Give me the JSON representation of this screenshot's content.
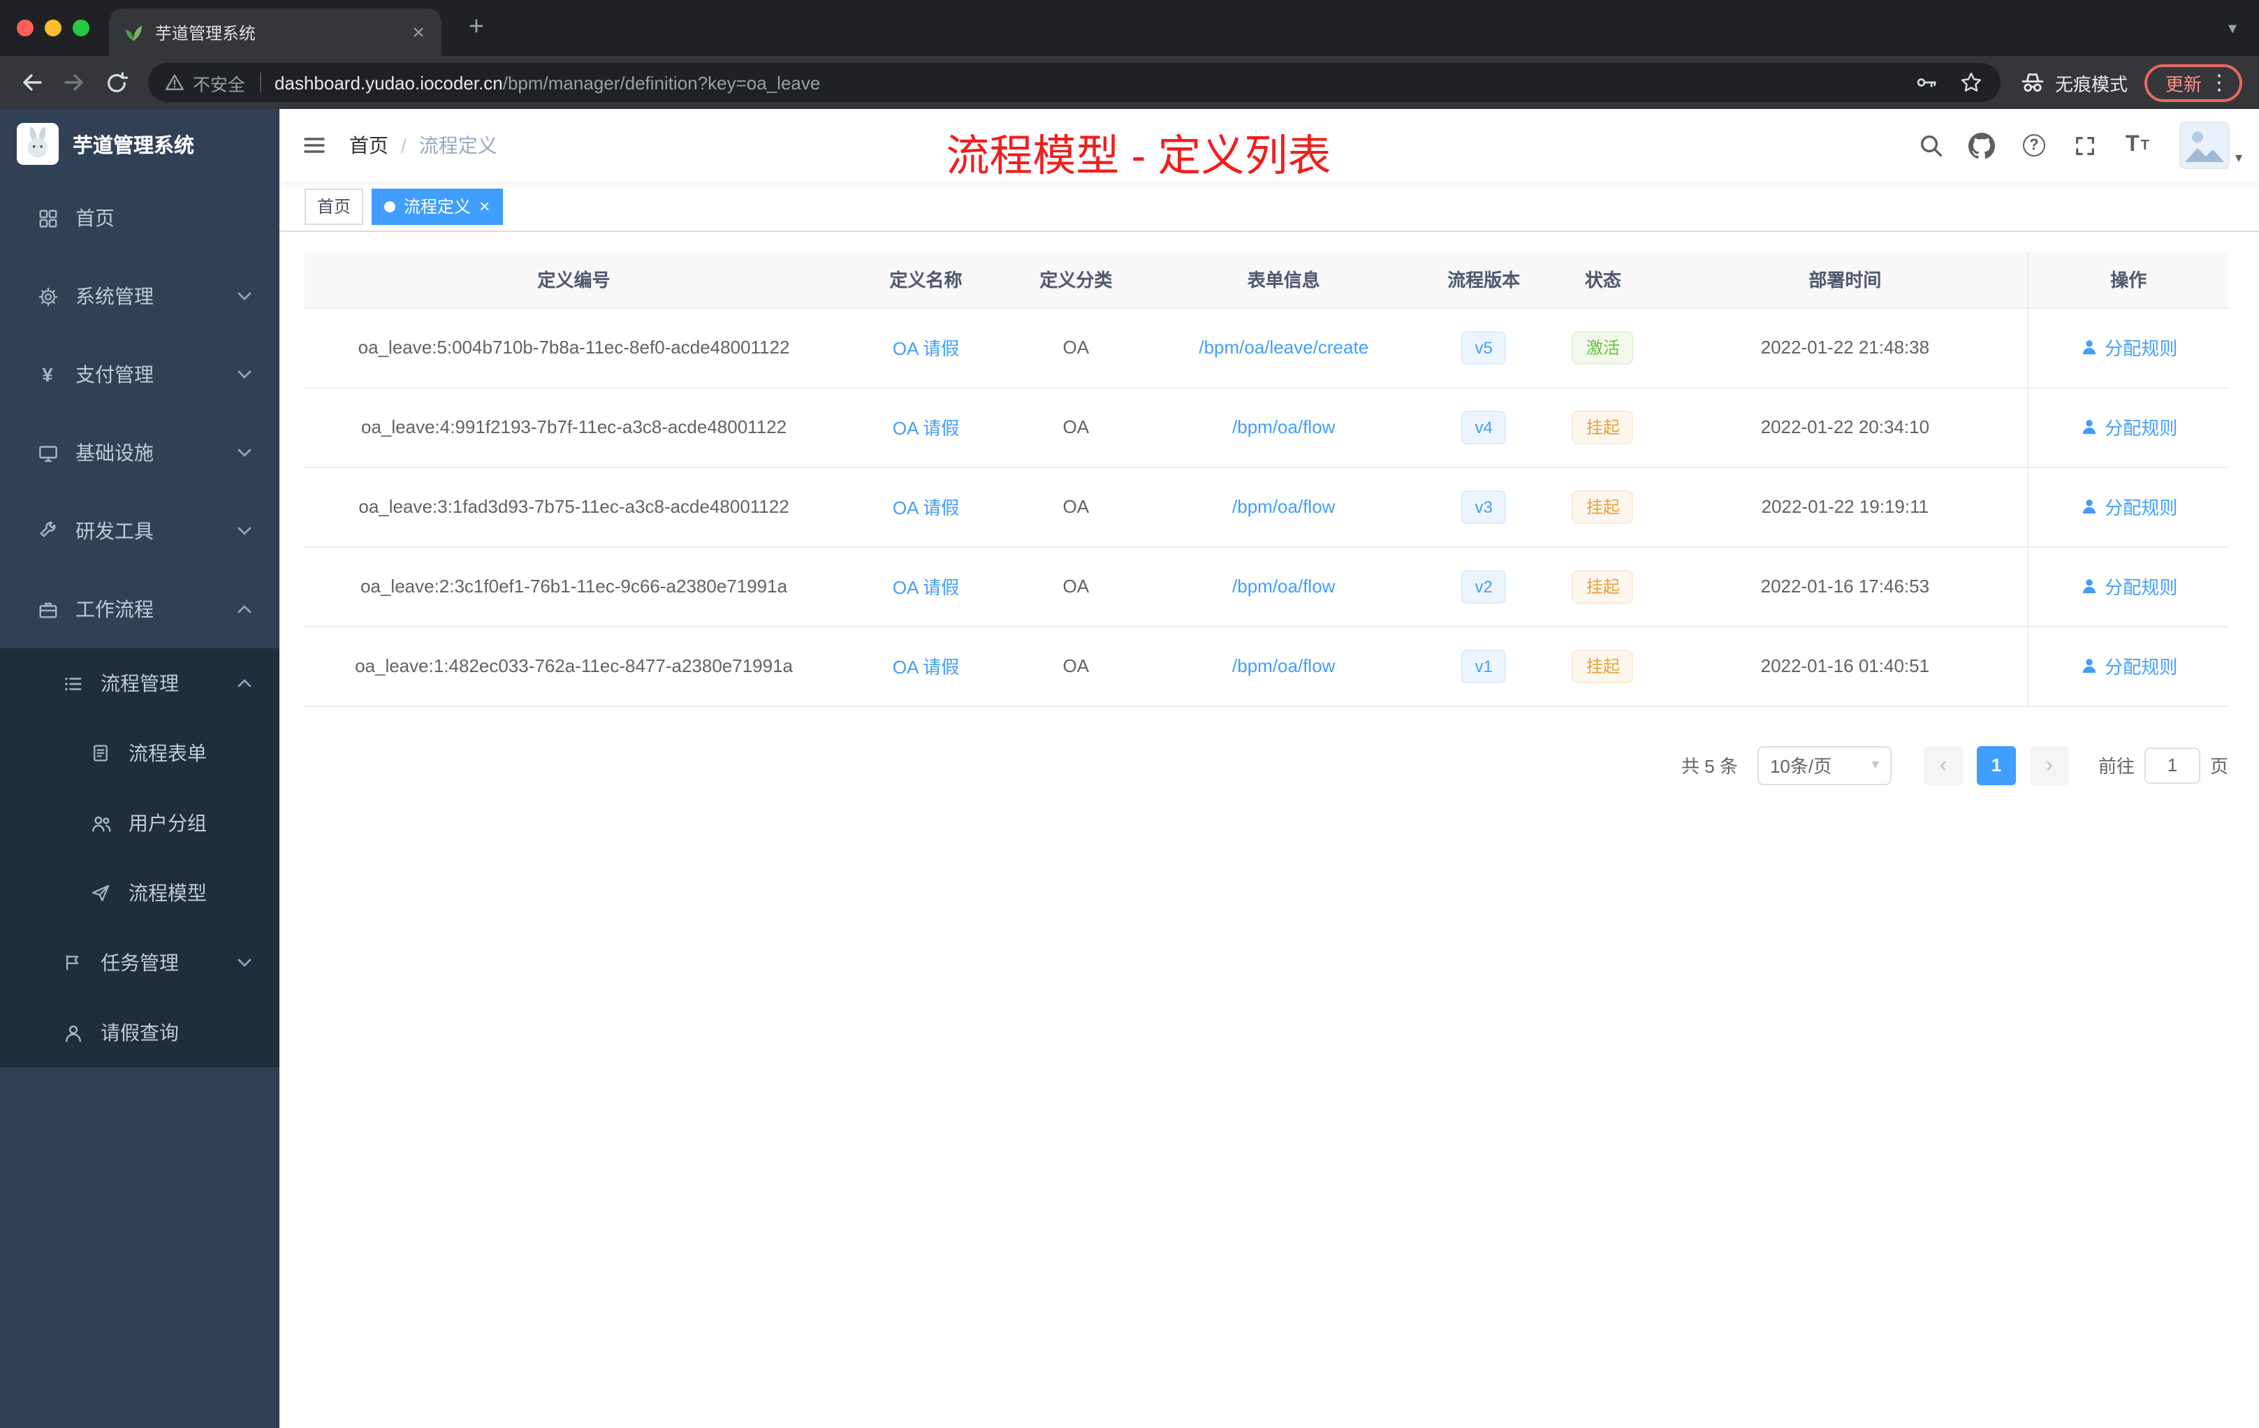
{
  "colors": {
    "accent": "#409eff",
    "annotation": "#f21d1d",
    "success": "#67c23a",
    "warning": "#e6a23c",
    "sidebar_bg": "#304156",
    "submenu_bg": "#1f2d3d"
  },
  "icons": {
    "close": "×",
    "plus": "+",
    "dots": "⋮",
    "caret": "▾",
    "question": "?",
    "yen": "¥",
    "font_large": "T",
    "font_small": "T"
  },
  "browser": {
    "tab_title": "芋道管理系统",
    "security_label": "不安全",
    "url_domain": "dashboard.yudao.iocoder.cn",
    "url_path": "/bpm/manager/definition?key=oa_leave",
    "incognito_label": "无痕模式",
    "update_label": "更新"
  },
  "sidebar": {
    "logo_title": "芋道管理系统",
    "items": [
      {
        "label": "首页"
      },
      {
        "label": "系统管理"
      },
      {
        "label": "支付管理"
      },
      {
        "label": "基础设施"
      },
      {
        "label": "研发工具"
      },
      {
        "label": "工作流程"
      },
      {
        "label": "流程管理"
      },
      {
        "label": "流程表单"
      },
      {
        "label": "用户分组"
      },
      {
        "label": "流程模型"
      },
      {
        "label": "任务管理"
      },
      {
        "label": "请假查询"
      }
    ]
  },
  "header": {
    "breadcrumb_home": "首页",
    "breadcrumb_sep": "/",
    "breadcrumb_current": "流程定义",
    "annotation": "流程模型 - 定义列表"
  },
  "tags": {
    "home": "首页",
    "current": "流程定义"
  },
  "table": {
    "columns": [
      "定义编号",
      "定义名称",
      "定义分类",
      "表单信息",
      "流程版本",
      "状态",
      "部署时间",
      "操作"
    ],
    "rows": [
      {
        "id": "oa_leave:5:004b710b-7b8a-11ec-8ef0-acde48001122",
        "name": "OA 请假",
        "category": "OA",
        "form": "/bpm/oa/leave/create",
        "version": "v5",
        "status": "激活",
        "status_type": "success",
        "time": "2022-01-22 21:48:38",
        "action": "分配规则"
      },
      {
        "id": "oa_leave:4:991f2193-7b7f-11ec-a3c8-acde48001122",
        "name": "OA 请假",
        "category": "OA",
        "form": "/bpm/oa/flow",
        "version": "v4",
        "status": "挂起",
        "status_type": "warning",
        "time": "2022-01-22 20:34:10",
        "action": "分配规则"
      },
      {
        "id": "oa_leave:3:1fad3d93-7b75-11ec-a3c8-acde48001122",
        "name": "OA 请假",
        "category": "OA",
        "form": "/bpm/oa/flow",
        "version": "v3",
        "status": "挂起",
        "status_type": "warning",
        "time": "2022-01-22 19:19:11",
        "action": "分配规则"
      },
      {
        "id": "oa_leave:2:3c1f0ef1-76b1-11ec-9c66-a2380e71991a",
        "name": "OA 请假",
        "category": "OA",
        "form": "/bpm/oa/flow",
        "version": "v2",
        "status": "挂起",
        "status_type": "warning",
        "time": "2022-01-16 17:46:53",
        "action": "分配规则"
      },
      {
        "id": "oa_leave:1:482ec033-762a-11ec-8477-a2380e71991a",
        "name": "OA 请假",
        "category": "OA",
        "form": "/bpm/oa/flow",
        "version": "v1",
        "status": "挂起",
        "status_type": "warning",
        "time": "2022-01-16 01:40:51",
        "action": "分配规则"
      }
    ]
  },
  "pagination": {
    "total": "共 5 条",
    "page_size": "10条/页",
    "prev": "‹",
    "page": "1",
    "next": "›",
    "goto_label": "前往",
    "goto_value": "1",
    "unit": "页"
  }
}
